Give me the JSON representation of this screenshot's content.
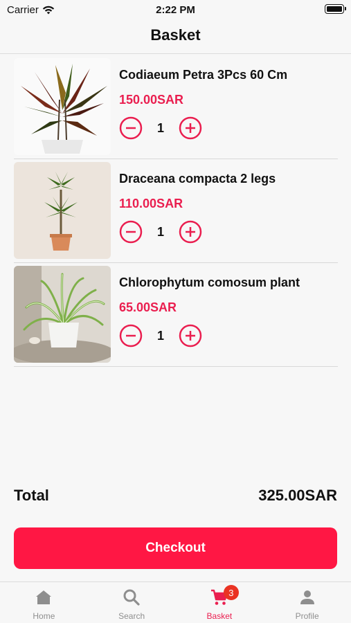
{
  "status_bar": {
    "carrier": "Carrier",
    "time": "2:22 PM"
  },
  "header": {
    "title": "Basket"
  },
  "items": [
    {
      "name": "Codiaeum Petra 3Pcs 60 Cm",
      "price": "150.00SAR",
      "quantity": "1"
    },
    {
      "name": "Draceana compacta 2 legs",
      "price": "110.00SAR",
      "quantity": "1"
    },
    {
      "name": "Chlorophytum comosum plant",
      "price": "65.00SAR",
      "quantity": "1"
    }
  ],
  "summary": {
    "total_label": "Total",
    "total_value": "325.00SAR"
  },
  "checkout": {
    "label": "Checkout"
  },
  "tabs": [
    {
      "label": "Home",
      "icon": "home-icon"
    },
    {
      "label": "Search",
      "icon": "search-icon"
    },
    {
      "label": "Basket",
      "icon": "cart-icon",
      "badge": "3"
    },
    {
      "label": "Profile",
      "icon": "person-icon"
    }
  ],
  "colors": {
    "accent": "#ea1e4f",
    "button": "#ff1744",
    "badge": "#ea3323"
  }
}
